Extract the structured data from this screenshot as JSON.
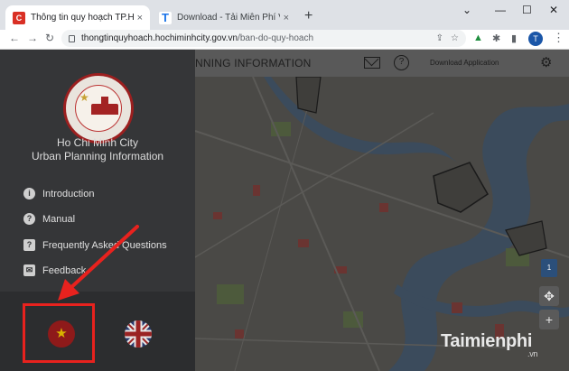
{
  "browser": {
    "tabs": [
      {
        "favicon": "C",
        "title": "Thông tin quy hoạch TP.HCM",
        "close": "×"
      },
      {
        "favicon": "T",
        "title": "Download - Tải Miễn Phí VN - Ph",
        "close": "×"
      }
    ],
    "new_tab": "+",
    "window_controls": {
      "dropdown": "⌄",
      "minimize": "—",
      "maximize": "☐",
      "close": "✕"
    },
    "nav": {
      "back": "←",
      "forward": "→",
      "reload": "↻"
    },
    "url_host": "thongtinquyhoach.hochiminhcity.gov.vn",
    "url_path": "/ban-do-quy-hoach",
    "omnibox_icons": {
      "share": "⇪",
      "bookmark": "☆"
    },
    "extensions": {
      "drive": "▲",
      "puzzle": "✱",
      "sidepanel": "▮"
    },
    "profile_initial": "T",
    "menu": "⋮"
  },
  "page": {
    "title_partial": "NNING INFORMATION",
    "download_label": "Download Application",
    "help_glyph": "?",
    "apple_glyph": "",
    "android_glyph": "⚙"
  },
  "sidebar": {
    "title_line1": "Ho Chi Minh City",
    "title_line2": "Urban Planning Information",
    "menu": [
      {
        "icon": "i",
        "label": "Introduction"
      },
      {
        "icon": "?",
        "label": "Manual"
      },
      {
        "icon": "?",
        "label": "Frequently Asked Questions"
      },
      {
        "icon": "✉",
        "label": "Feedback"
      }
    ],
    "languages": {
      "vn_star": "★"
    }
  },
  "map": {
    "controls": {
      "locate": "✥",
      "zoom_in": "+"
    },
    "layer_badge": "1"
  },
  "watermark": {
    "brand": "Taimienphi",
    "tld": ".vn"
  },
  "colors": {
    "highlight": "#e8221e",
    "arrow": "#e8221e",
    "sidebar_bg": "#353638",
    "chrome_tabstrip": "#dee1e6"
  }
}
